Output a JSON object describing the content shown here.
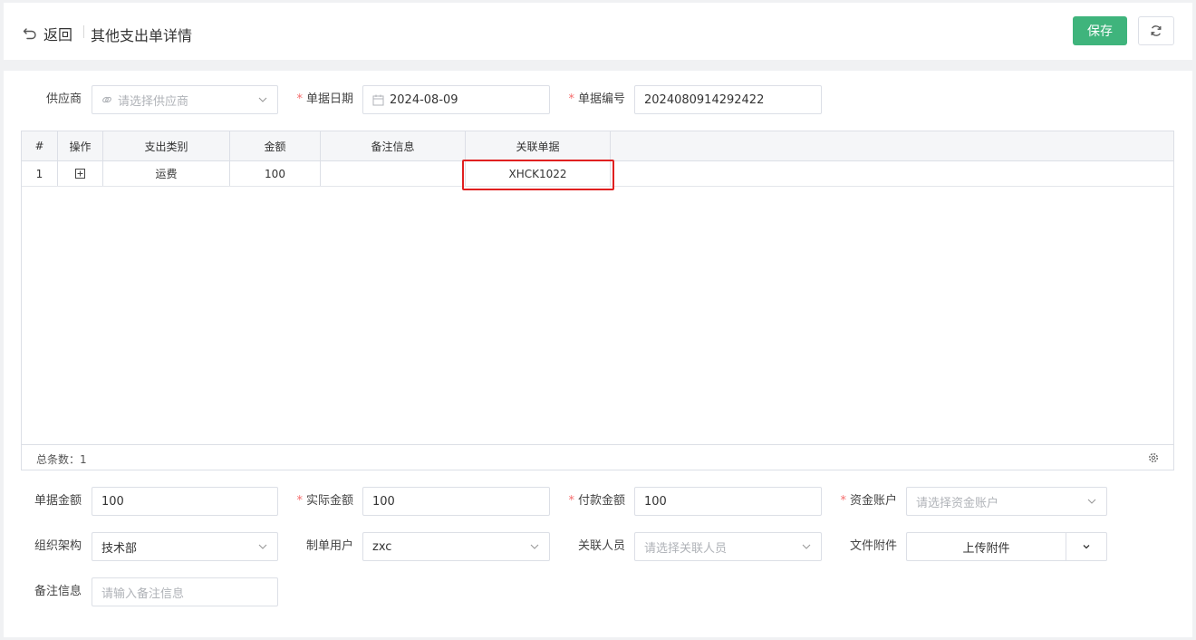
{
  "header": {
    "back_label": "返回",
    "title": "其他支出单详情",
    "save_label": "保存"
  },
  "form_top": {
    "supplier": {
      "label": "供应商",
      "placeholder": "请选择供应商"
    },
    "date": {
      "label": "单据日期",
      "value": "2024-08-09"
    },
    "number": {
      "label": "单据编号",
      "value": "2024080914292422"
    }
  },
  "table": {
    "columns": [
      "#",
      "操作",
      "支出类别",
      "金额",
      "备注信息",
      "关联单据"
    ],
    "rows": [
      {
        "index": "1",
        "category": "运费",
        "amount": "100",
        "remark": "",
        "related": "XHCK1022"
      }
    ],
    "total_label": "总条数：1"
  },
  "form_bottom": {
    "bill_amount": {
      "label": "单据金额",
      "value": "100"
    },
    "actual_amount": {
      "label": "实际金额",
      "value": "100"
    },
    "pay_amount": {
      "label": "付款金额",
      "value": "100"
    },
    "account": {
      "label": "资金账户",
      "placeholder": "请选择资金账户"
    },
    "org": {
      "label": "组织架构",
      "value": "技术部"
    },
    "creator": {
      "label": "制单用户",
      "value": "zxc"
    },
    "related_person": {
      "label": "关联人员",
      "placeholder": "请选择关联人员"
    },
    "attachment": {
      "label": "文件附件",
      "button": "上传附件"
    },
    "remark": {
      "label": "备注信息",
      "placeholder": "请输入备注信息"
    }
  },
  "colors": {
    "primary": "#3fb47c",
    "required": "#f56c6c",
    "highlight": "#e02020"
  }
}
